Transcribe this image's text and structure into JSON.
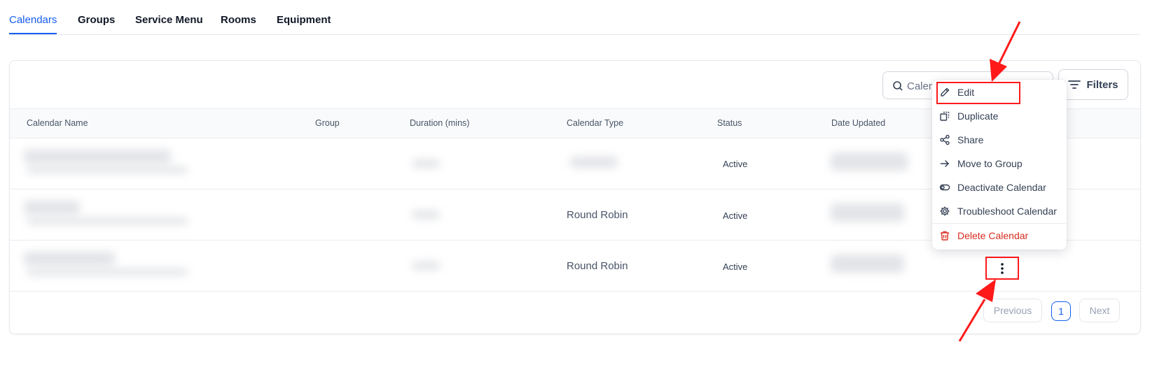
{
  "tabs": [
    {
      "label": "Calendars",
      "active": true
    },
    {
      "label": "Groups",
      "active": false
    },
    {
      "label": "Service Menu",
      "active": false
    },
    {
      "label": "Rooms",
      "active": false
    },
    {
      "label": "Equipment",
      "active": false
    }
  ],
  "toolbar": {
    "search_placeholder": "Calendar",
    "filters_label": "Filters"
  },
  "table": {
    "headers": [
      "Calendar Name",
      "Group",
      "Duration (mins)",
      "Calendar Type",
      "Status",
      "Date Updated"
    ],
    "rows": [
      {
        "calendar_type": "",
        "status": "Active"
      },
      {
        "calendar_type": "Round Robin",
        "status": "Active"
      },
      {
        "calendar_type": "Round Robin",
        "status": "Active"
      }
    ]
  },
  "pagination": {
    "previous": "Previous",
    "current_page": "1",
    "next": "Next"
  },
  "menu": {
    "items": [
      {
        "label": "Edit",
        "icon": "pencil-icon"
      },
      {
        "label": "Duplicate",
        "icon": "duplicate-icon"
      },
      {
        "label": "Share",
        "icon": "share-icon"
      },
      {
        "label": "Move to Group",
        "icon": "arrow-right-icon"
      },
      {
        "label": "Deactivate Calendar",
        "icon": "toggle-icon"
      },
      {
        "label": "Troubleshoot Calendar",
        "icon": "gear-icon"
      },
      {
        "label": "Delete Calendar",
        "icon": "trash-icon"
      }
    ]
  },
  "colors": {
    "accent": "#155eef",
    "danger": "#d92d20",
    "annotation": "#ff1a1a"
  }
}
